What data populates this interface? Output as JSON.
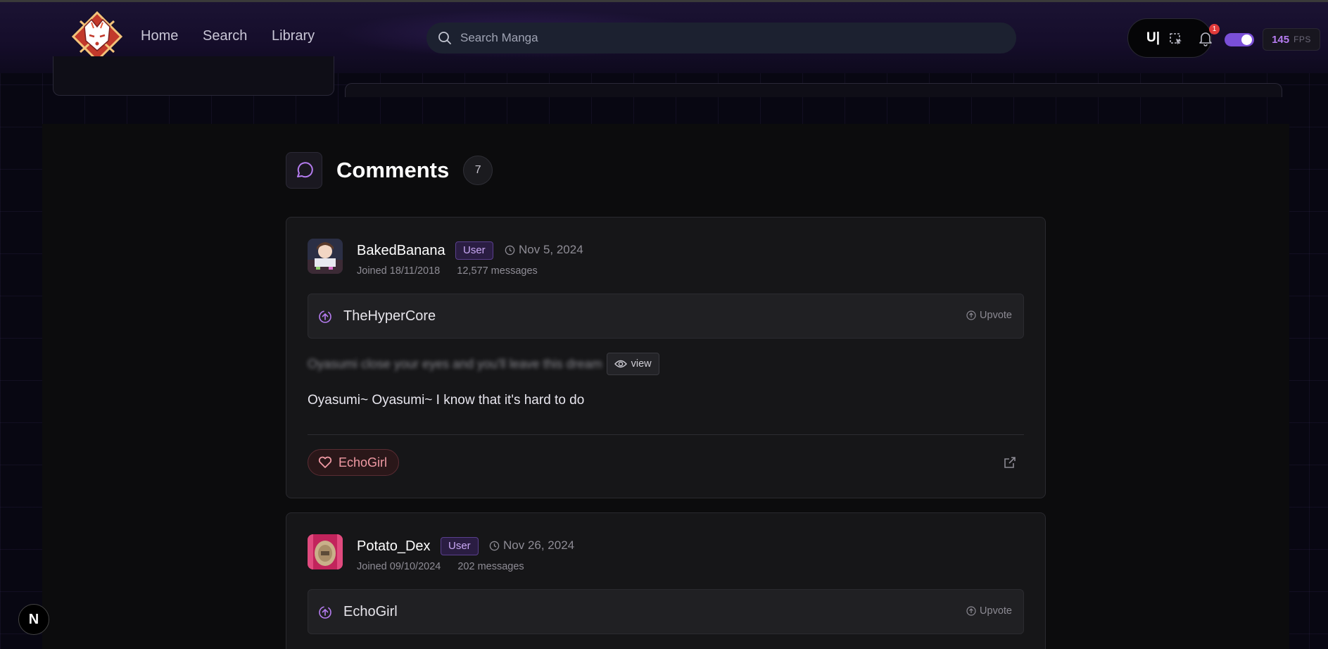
{
  "nav": {
    "home": "Home",
    "search": "Search",
    "library": "Library"
  },
  "search": {
    "placeholder": "Search Manga"
  },
  "toolbar": {
    "ui_text": "U|",
    "notification_count": "1",
    "fps_value": "145",
    "fps_label": "FPS"
  },
  "comments": {
    "title": "Comments",
    "count": "7",
    "items": [
      {
        "username": "BakedBanana",
        "role": "User",
        "date": "Nov 5, 2024",
        "joined": "Joined 18/11/2018",
        "messages": "12,577 messages",
        "reply_to": "TheHyperCore",
        "upvote_label": "Upvote",
        "spoiler": "Oyasumi close your eyes and you'll leave this dream",
        "view_label": "view",
        "text": "Oyasumi~ Oyasumi~ I know that it's hard to do",
        "liked_by": "EchoGirl"
      },
      {
        "username": "Potato_Dex",
        "role": "User",
        "date": "Nov 26, 2024",
        "joined": "Joined 09/10/2024",
        "messages": "202 messages",
        "reply_to": "EchoGirl",
        "upvote_label": "Upvote"
      }
    ]
  },
  "dev_badge": "N",
  "colors": {
    "accent": "#b57cf0",
    "like": "#f09aa4",
    "notification": "#e03a3a"
  }
}
